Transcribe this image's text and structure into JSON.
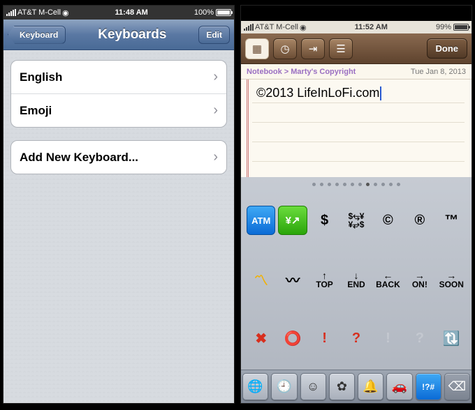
{
  "left": {
    "status": {
      "carrier": "AT&T M-Cell",
      "time": "11:48 AM",
      "battery_pct": "100%",
      "battery_fill": "100%"
    },
    "nav": {
      "back_label": "Keyboard",
      "title": "Keyboards",
      "edit_label": "Edit"
    },
    "keyboards": [
      {
        "label": "English"
      },
      {
        "label": "Emoji"
      }
    ],
    "add_label": "Add New Keyboard..."
  },
  "right": {
    "status": {
      "carrier": "AT&T M-Cell",
      "time": "11:52 AM",
      "battery_pct": "99%",
      "battery_fill": "99%"
    },
    "toolbar": {
      "icons": [
        "calendar",
        "clock",
        "jump",
        "list"
      ],
      "done_label": "Done"
    },
    "note": {
      "breadcrumb": "Notebook > Marty's Copyright",
      "date": "Tue Jan 8, 2013",
      "text": "©2013 LifeInLoFi.com"
    },
    "keyboard": {
      "page_dots": 12,
      "active_dot": 7,
      "rows": [
        [
          {
            "kind": "atm",
            "text": "ATM"
          },
          {
            "kind": "green",
            "text": "¥📈",
            "render": "chart"
          },
          {
            "kind": "plain",
            "text": "$"
          },
          {
            "kind": "plain",
            "text": "$↔¥",
            "render": "exchange"
          },
          {
            "kind": "plain",
            "text": "©"
          },
          {
            "kind": "plain",
            "text": "®"
          },
          {
            "kind": "plain",
            "text": "™"
          }
        ],
        [
          {
            "kind": "zig",
            "text": "〽"
          },
          {
            "kind": "plain",
            "text": "〰"
          },
          {
            "kind": "plain",
            "text": "TOP",
            "render": "arrowlabel",
            "arrow": "↑"
          },
          {
            "kind": "plain",
            "text": "END",
            "render": "arrowlabel",
            "arrow": "↓"
          },
          {
            "kind": "plain",
            "text": "BACK",
            "render": "arrowlabel",
            "arrow": "←"
          },
          {
            "kind": "plain",
            "text": "ON!",
            "render": "arrowlabel",
            "arrow": "→"
          },
          {
            "kind": "plain",
            "text": "SOON",
            "render": "arrowlabel",
            "arrow": "→"
          }
        ],
        [
          {
            "kind": "red",
            "text": "✖"
          },
          {
            "kind": "red",
            "text": "⭕"
          },
          {
            "kind": "red",
            "text": "!"
          },
          {
            "kind": "red",
            "text": "?"
          },
          {
            "kind": "faded",
            "text": "!"
          },
          {
            "kind": "faded",
            "text": "?"
          },
          {
            "kind": "plain",
            "text": "🔃"
          }
        ]
      ],
      "categories": [
        {
          "icon": "globe",
          "glyph": "🌐"
        },
        {
          "icon": "recent",
          "glyph": "🕘"
        },
        {
          "icon": "smiley",
          "glyph": "☺"
        },
        {
          "icon": "flower",
          "glyph": "✿"
        },
        {
          "icon": "bell",
          "glyph": "🔔"
        },
        {
          "icon": "car",
          "glyph": "🚗"
        },
        {
          "icon": "symbols",
          "glyph": "!?#",
          "active": true
        },
        {
          "icon": "delete",
          "glyph": "⌫",
          "del": true
        }
      ]
    }
  }
}
